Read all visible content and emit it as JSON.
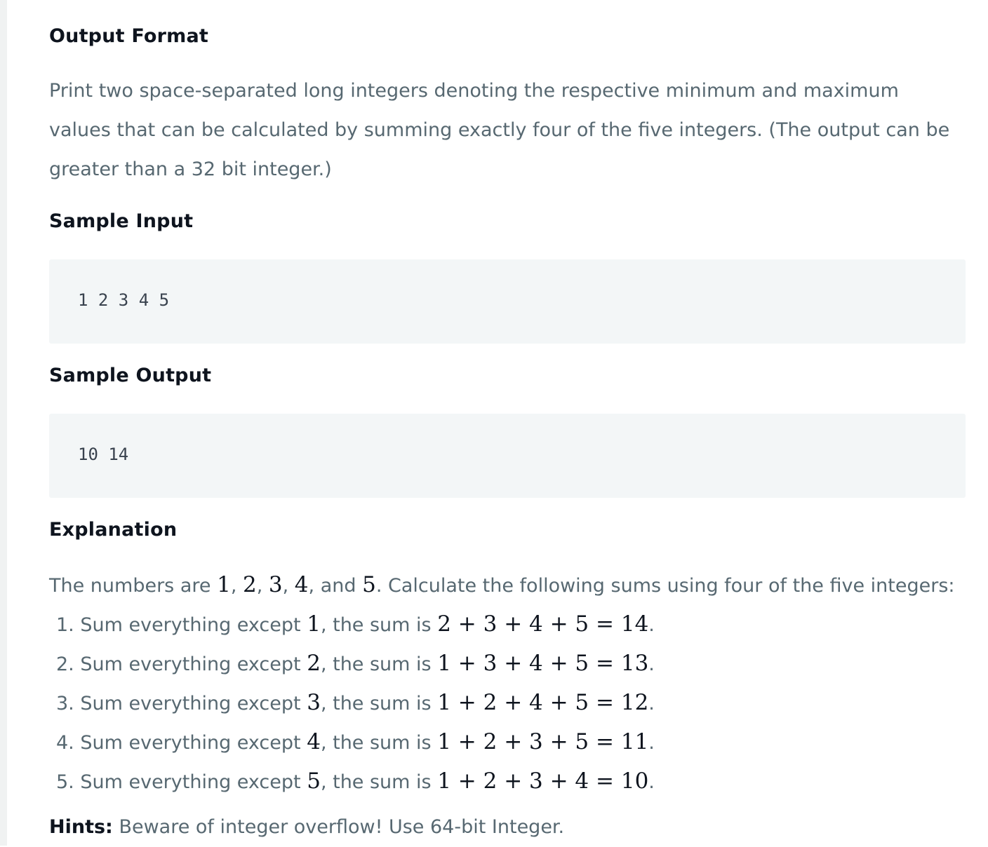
{
  "output_format": {
    "heading": "Output Format",
    "text": "Print two space-separated long integers denoting the respective minimum and maximum values that can be calculated by summing exactly four of the five integers. (The output can be greater than a 32 bit integer.)"
  },
  "sample_input": {
    "heading": "Sample Input",
    "code": "1 2 3 4 5"
  },
  "sample_output": {
    "heading": "Sample Output",
    "code": "10 14"
  },
  "explanation": {
    "heading": "Explanation",
    "intro_prefix": "The numbers are ",
    "numbers": [
      "1",
      "2",
      "3",
      "4",
      "5"
    ],
    "sep_1": ", ",
    "sep_2": ", ",
    "sep_3": ", ",
    "sep_4": ", and ",
    "intro_suffix": ". Calculate the following sums using four of the five integers:",
    "items": [
      {
        "prefix": "1. Sum everything except ",
        "excluded": "1",
        "middle": ", the sum is ",
        "expr": "2 + 3 + 4 + 5 = 14",
        "suffix": "."
      },
      {
        "prefix": "2. Sum everything except ",
        "excluded": "2",
        "middle": ", the sum is ",
        "expr": "1 + 3 + 4 + 5 = 13",
        "suffix": "."
      },
      {
        "prefix": "3. Sum everything except ",
        "excluded": "3",
        "middle": ", the sum is ",
        "expr": "1 + 2 + 4 + 5 = 12",
        "suffix": "."
      },
      {
        "prefix": "4. Sum everything except ",
        "excluded": "4",
        "middle": ", the sum is ",
        "expr": "1 + 2 + 3 + 5 = 11",
        "suffix": "."
      },
      {
        "prefix": "5. Sum everything except ",
        "excluded": "5",
        "middle": ", the sum is ",
        "expr": "1 + 2 + 3 + 4 = 10",
        "suffix": "."
      }
    ]
  },
  "hints": {
    "label": "Hints:",
    "text": " Beware of integer overflow! Use 64-bit Integer."
  }
}
